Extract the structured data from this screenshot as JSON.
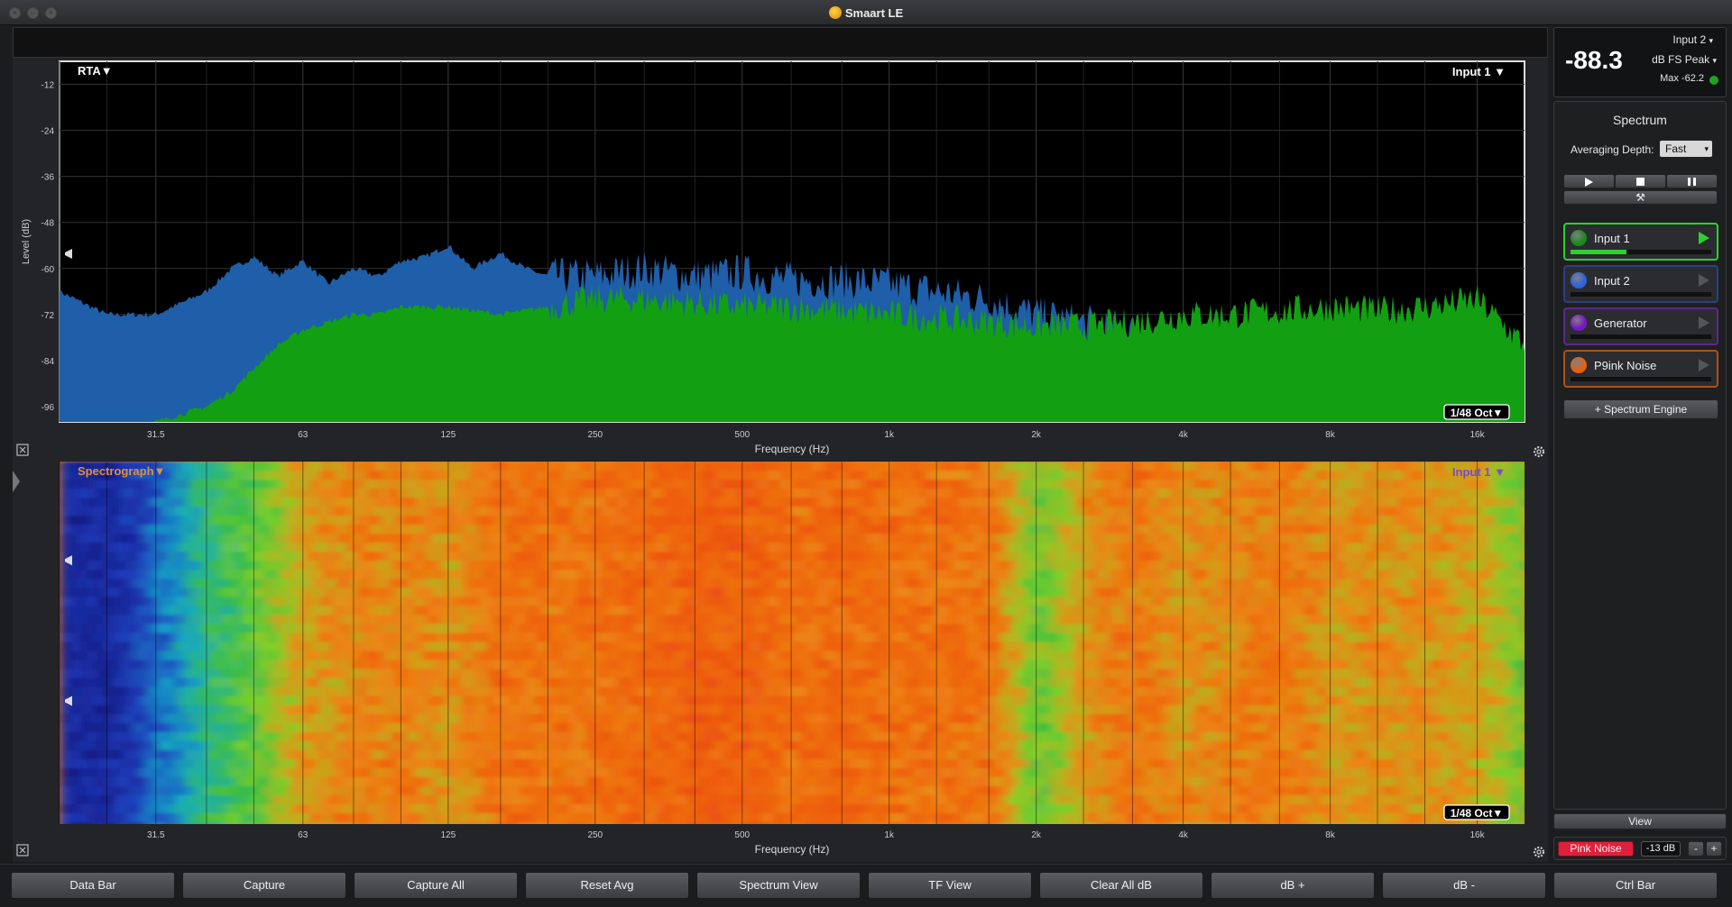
{
  "window": {
    "title": "Smaart LE"
  },
  "rta": {
    "mode_label": "RTA▼",
    "input_label": "Input 1 ▼",
    "resolution_label": "1/48 Oct▼",
    "ylabel": "Level (dB)",
    "xlabel": "Frequency (Hz)"
  },
  "spectrograph": {
    "mode_label": "Spectrograph▼",
    "input_label": "Input 1 ▼",
    "resolution_label": "1/48 Oct▼",
    "xlabel": "Frequency (Hz)"
  },
  "chart_data": [
    {
      "type": "area",
      "title": "RTA",
      "xlabel": "Frequency (Hz)",
      "ylabel": "Level (dB)",
      "x_scale": "log",
      "xlim": [
        20,
        20000
      ],
      "ylim": [
        -100,
        -6
      ],
      "x_ticks": [
        "31.5",
        "63",
        "125",
        "250",
        "500",
        "1k",
        "2k",
        "4k",
        "8k",
        "16k"
      ],
      "y_ticks": [
        "-12",
        "-24",
        "-36",
        "-48",
        "-60",
        "-72",
        "-84",
        "-96"
      ],
      "grid": true,
      "series": [
        {
          "name": "Input 1",
          "color": "#1f5ea8",
          "x": [
            20,
            25,
            31.5,
            40,
            45,
            50,
            56,
            63,
            71,
            80,
            90,
            100,
            112,
            125,
            140,
            160,
            180,
            200,
            250,
            315,
            400,
            500,
            630,
            800,
            1000,
            1250,
            1600,
            2000,
            2500,
            3150,
            4000,
            5000,
            6300,
            8000,
            10000,
            12500,
            16000,
            20000
          ],
          "y": [
            -66,
            -72,
            -72,
            -66,
            -60,
            -57,
            -62,
            -58,
            -64,
            -60,
            -62,
            -58,
            -57,
            -54,
            -60,
            -56,
            -60,
            -62,
            -62,
            -60,
            -62,
            -61,
            -63,
            -63,
            -64,
            -66,
            -68,
            -72,
            -74,
            -76,
            -80,
            -84,
            -88,
            -88,
            -90,
            -92,
            -96,
            -98
          ]
        },
        {
          "name": "Pink Noise",
          "color": "#12a012",
          "x": [
            20,
            25,
            31.5,
            40,
            45,
            50,
            56,
            63,
            71,
            80,
            90,
            100,
            125,
            160,
            200,
            250,
            315,
            400,
            500,
            630,
            800,
            1000,
            1250,
            1600,
            2000,
            2500,
            3150,
            4000,
            5000,
            6300,
            8000,
            10000,
            12500,
            16000,
            20000
          ],
          "y": [
            -104,
            -103,
            -100,
            -96,
            -92,
            -86,
            -80,
            -76,
            -74,
            -72,
            -72,
            -70,
            -70,
            -72,
            -70,
            -68,
            -68,
            -69,
            -70,
            -70,
            -71,
            -72,
            -73,
            -74,
            -75,
            -75,
            -74,
            -72,
            -72,
            -71,
            -70,
            -71,
            -70,
            -68,
            -80
          ]
        }
      ]
    },
    {
      "type": "heatmap",
      "title": "Spectrograph",
      "xlabel": "Frequency (Hz)",
      "x_scale": "log",
      "xlim": [
        20,
        20000
      ],
      "x_ticks": [
        "31.5",
        "63",
        "125",
        "250",
        "500",
        "1k",
        "2k",
        "4k",
        "8k",
        "16k"
      ],
      "bands_hz": [
        20,
        25,
        31.5,
        40,
        50,
        63,
        80,
        100,
        125,
        160,
        200,
        250,
        315,
        400,
        500,
        630,
        800,
        1000,
        1250,
        1600,
        2000,
        2500,
        3150,
        4000,
        5000,
        6300,
        8000,
        10000,
        12500,
        16000,
        20000
      ],
      "level_index": [
        0.1,
        0.1,
        0.25,
        0.45,
        0.55,
        0.7,
        0.75,
        0.75,
        0.72,
        0.8,
        0.78,
        0.8,
        0.82,
        0.85,
        0.85,
        0.8,
        0.82,
        0.8,
        0.8,
        0.78,
        0.55,
        0.72,
        0.78,
        0.72,
        0.75,
        0.78,
        0.72,
        0.72,
        0.72,
        0.7,
        0.55
      ]
    }
  ],
  "meter": {
    "input_select": "Input 2",
    "value": "-88.3",
    "units": "dB FS Peak",
    "max_label": "Max -62.2",
    "status_color": "#1fa31f"
  },
  "spectrum_panel": {
    "title": "Spectrum",
    "averaging_label": "Averaging Depth:",
    "averaging_value": "Fast",
    "tools_icon": "tools-icon",
    "inputs": [
      {
        "label": "Input 1",
        "color": "#1a8a1a",
        "border": "#2ed02e",
        "level": 0.4
      },
      {
        "label": "Input 2",
        "color": "#2e62e0",
        "border": "#2a3f8a",
        "level": 0.0
      },
      {
        "label": "Generator",
        "color": "#7a16c8",
        "border": "#5a2a8a",
        "level": 0.0
      },
      {
        "label": "P9ink Noise",
        "color": "#e8600e",
        "border": "#b0501a",
        "level": 0.0
      }
    ],
    "add_engine_label": "+ Spectrum Engine",
    "view_label": "View",
    "generator_label": "Pink Noise",
    "generator_level": "-13 dB",
    "minus_label": "-",
    "plus_label": "+"
  },
  "bottom_bar": [
    "Data Bar",
    "Capture",
    "Capture All",
    "Reset Avg",
    "Spectrum View",
    "TF View",
    "Clear All dB",
    "dB +",
    "dB -",
    "Ctrl Bar"
  ]
}
